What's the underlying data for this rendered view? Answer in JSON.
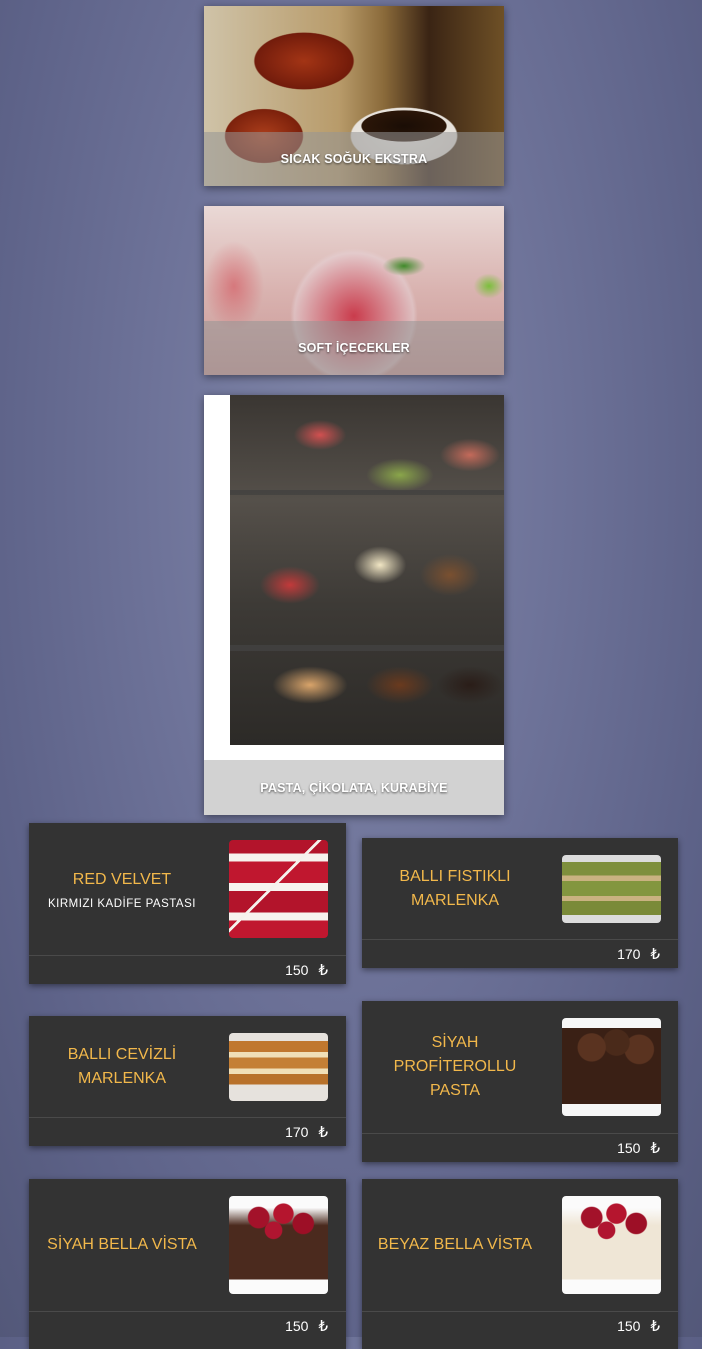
{
  "categories": [
    {
      "label": "SICAK SOĞUK EKSTRA"
    },
    {
      "label": "SOFT İÇECEKLER"
    },
    {
      "label": "PASTA, ÇİKOLATA, KURABİYE"
    }
  ],
  "currency_symbol": "₺",
  "products": [
    {
      "title": "RED VELVET",
      "subtitle": "KIRMIZI KADİFE PASTASI",
      "price": "150"
    },
    {
      "title": "BALLI FISTIKLI MARLENKA",
      "subtitle": "",
      "price": "170"
    },
    {
      "title": "BALLI CEVİZLİ MARLENKA",
      "subtitle": "",
      "price": "170"
    },
    {
      "title": "SİYAH PROFİTEROLLU PASTA",
      "subtitle": "",
      "price": "150"
    },
    {
      "title": "SİYAH BELLA VİSTA",
      "subtitle": "",
      "price": "150"
    },
    {
      "title": "BEYAZ BELLA VİSTA",
      "subtitle": "",
      "price": "150"
    }
  ],
  "colors": {
    "accent_title": "#f2b84b",
    "card_bg": "#333333",
    "page_bg": "#6e7399"
  }
}
